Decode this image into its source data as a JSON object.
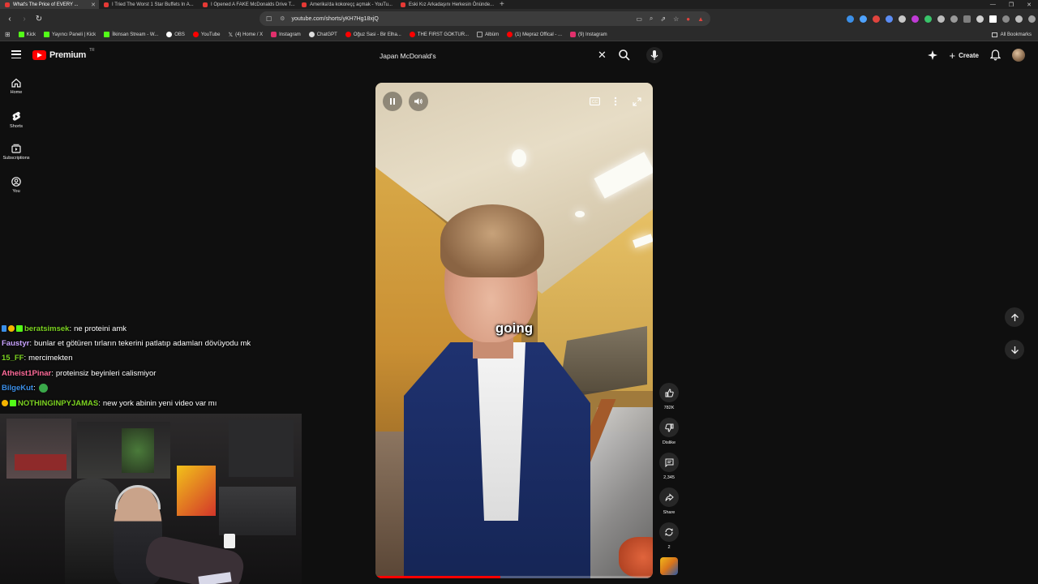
{
  "browser": {
    "tabs": [
      {
        "title": "What's The Price of EVERY ...",
        "active": true
      },
      {
        "title": "I Tried The Worst 1 Star Buffets In A...",
        "active": false
      },
      {
        "title": "I Opened A FAKE McDonalds Drive T...",
        "active": false
      },
      {
        "title": "Amerika'da kokoreçç açmak - YouTu...",
        "active": false
      },
      {
        "title": "Eski Kız Arkadaşını Herkesin Önünde...",
        "active": false
      }
    ],
    "url": "youtube.com/shorts/yKH7Hg18xjQ",
    "bookmarks": [
      {
        "label": "Kick",
        "color": "#53fc18"
      },
      {
        "label": "Yayıncı Paneli | Kick",
        "color": "#53fc18"
      },
      {
        "label": "İlkinsan Stream - W...",
        "color": "#53fc18"
      },
      {
        "label": "OBS",
        "color": "#ffffff"
      },
      {
        "label": "YouTube",
        "color": "#ff0000"
      },
      {
        "label": "(4) Home / X",
        "color": "#ffffff"
      },
      {
        "label": "Instagram",
        "color": "#e1306c"
      },
      {
        "label": "ChatGPT",
        "color": "#dddddd"
      },
      {
        "label": "Oğuz Sasi - Bir Elha...",
        "color": "#ff0000"
      },
      {
        "label": "THE FIRST GOKTUR...",
        "color": "#ff0000"
      },
      {
        "label": "Albüm",
        "color": "#aaaaaa"
      },
      {
        "label": "(1) Mepraz Offical - ...",
        "color": "#ff0000"
      },
      {
        "label": "(9) Instagram",
        "color": "#e1306c"
      }
    ],
    "all_bookmarks": "All Bookmarks"
  },
  "youtube": {
    "brand": "Premium",
    "brand_sup": "TR",
    "search_query": "Japan McDonald's",
    "create_label": "Create",
    "guide": [
      {
        "label": "Home",
        "icon": "home-icon"
      },
      {
        "label": "Shorts",
        "icon": "shorts-icon"
      },
      {
        "label": "Subscriptions",
        "icon": "subscriptions-icon"
      },
      {
        "label": "You",
        "icon": "you-icon"
      }
    ],
    "video": {
      "caption": "going",
      "progress_fraction": 0.45
    },
    "actions": {
      "likes": "782K",
      "dislike": "Dislike",
      "comments": "2,345",
      "share": "Share",
      "remix": "2"
    }
  },
  "chat": [
    {
      "user": "beratsimsek",
      "color": "#7cd321",
      "message": "ne proteini amk",
      "badges": [
        "#3b8fe8",
        "#f4b400",
        "#53fc18"
      ]
    },
    {
      "user": "Faustyr",
      "color": "#c8a2ff",
      "message": "bunlar et götüren tırların tekerini patlatıp adamları dövüyodu mk",
      "badges": []
    },
    {
      "user": "15_FF",
      "color": "#7cd321",
      "message": "mercimekten",
      "badges": []
    },
    {
      "user": "Atheist1Pinar",
      "color": "#ff6b9a",
      "message": "proteinsiz beyinleri calismiyor",
      "badges": []
    },
    {
      "user": "BilgeKut",
      "color": "#3b8fe8",
      "message": "",
      "badges": [],
      "emote": true
    },
    {
      "user": "NOTHINGINPYJAMAS",
      "color": "#7cd321",
      "message": "new york abinin yeni video var mı",
      "badges": [
        "#f4b400",
        "#53fc18"
      ]
    }
  ]
}
